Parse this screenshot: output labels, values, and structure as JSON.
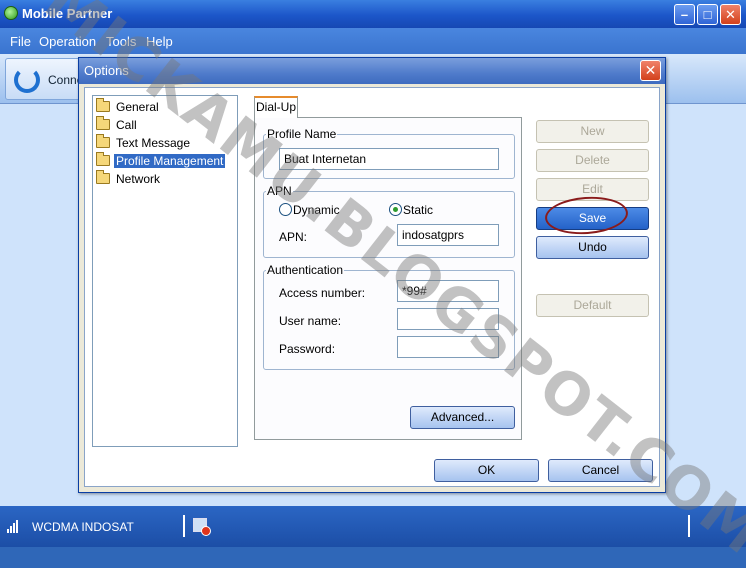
{
  "window": {
    "title": "Mobile Partner",
    "menus": [
      "File",
      "Operation",
      "Tools",
      "Help"
    ],
    "connect_label": "Conne"
  },
  "status": {
    "network": "WCDMA  INDOSAT"
  },
  "dialog": {
    "title": "Options",
    "tree": [
      "General",
      "Call",
      "Text Message",
      "Profile Management",
      "Network"
    ],
    "selected_tree_item": "Profile Management",
    "tab": "Dial-Up",
    "profile_group": "Profile Name",
    "profile_name": "Buat Internetan",
    "apn_group": "APN",
    "apn_dynamic": "Dynamic",
    "apn_static": "Static",
    "apn_mode": "Static",
    "apn_label": "APN:",
    "apn_value": "indosatgprs",
    "auth_group": "Authentication",
    "access_number_label": "Access number:",
    "access_number": "*99#",
    "user_name_label": "User name:",
    "user_name": "",
    "password_label": "Password:",
    "password": "",
    "advanced_button": "Advanced...",
    "buttons": {
      "new": "New",
      "delete": "Delete",
      "edit": "Edit",
      "save": "Save",
      "undo": "Undo",
      "default": "Default"
    },
    "ok": "OK",
    "cancel": "Cancel"
  },
  "watermark": "MICKAMU.BLOGSPOT.COM",
  "colors": {
    "title_blue": "#1c56c9",
    "dialog_bg": "#ece9d8",
    "selection": "#316ac5",
    "annotation": "#8a1b1b"
  }
}
